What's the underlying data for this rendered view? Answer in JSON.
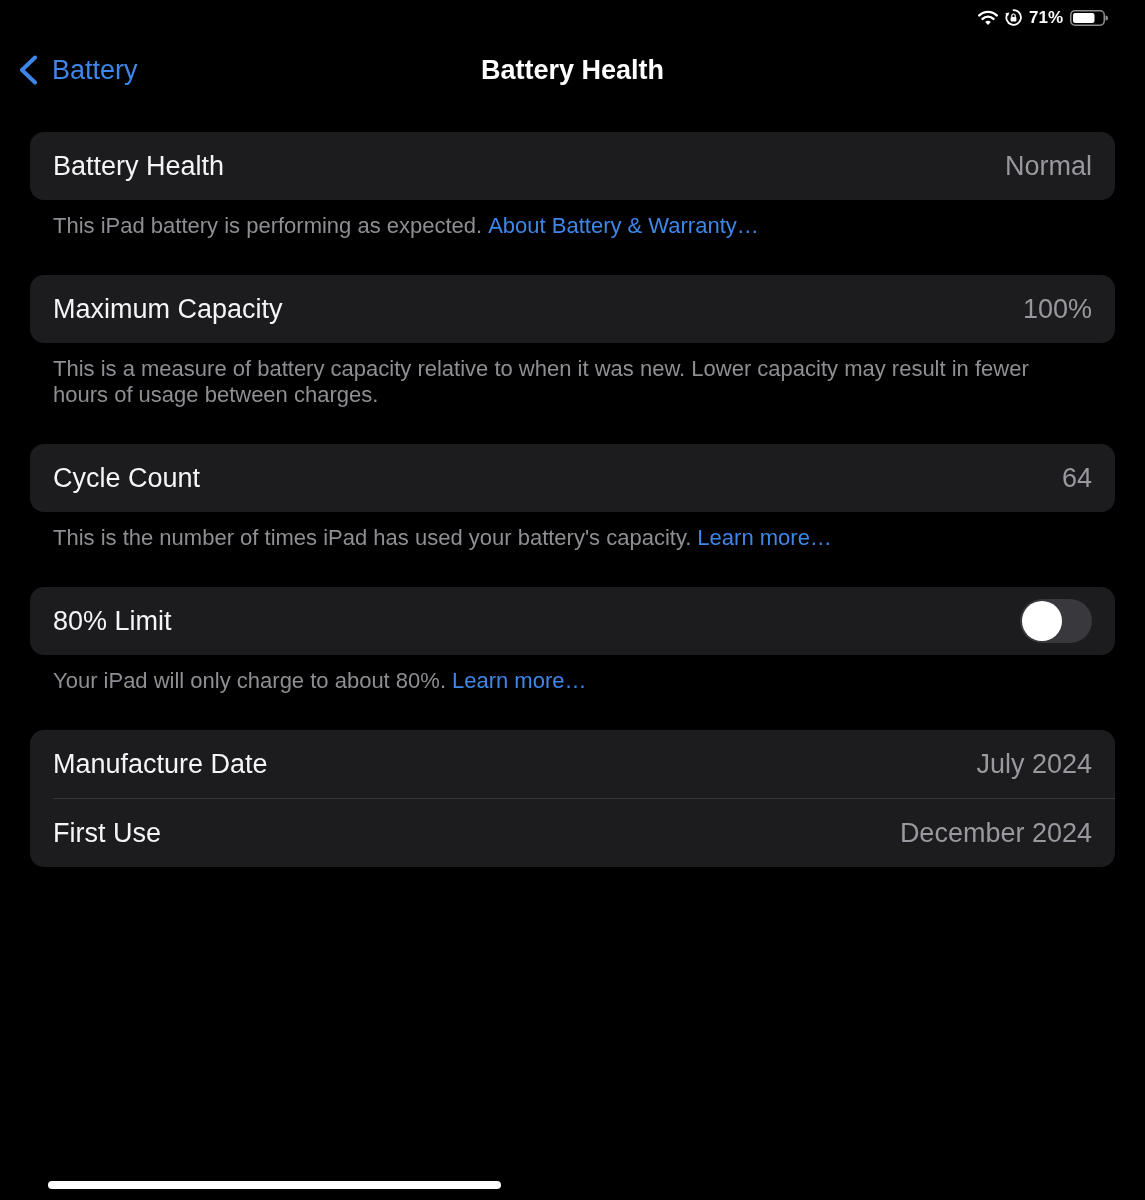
{
  "status_bar": {
    "battery_percent": "71%"
  },
  "nav_bar": {
    "back_label": "Battery",
    "title": "Battery Health"
  },
  "sections": [
    {
      "rows": [
        {
          "kind": "value",
          "label": "Battery Health",
          "value": "Normal"
        }
      ],
      "footer": {
        "text": "This iPad battery is performing as expected.",
        "link": "About Battery & Warranty…"
      }
    },
    {
      "rows": [
        {
          "kind": "value",
          "label": "Maximum Capacity",
          "value": "100%"
        }
      ],
      "footer": {
        "text": "This is a measure of battery capacity relative to when it was new. Lower capacity may result in fewer hours of usage between charges."
      }
    },
    {
      "rows": [
        {
          "kind": "value",
          "label": "Cycle Count",
          "value": "64"
        }
      ],
      "footer": {
        "text": "This is the number of times iPad has used your battery's capacity.",
        "link": "Learn more…"
      }
    },
    {
      "rows": [
        {
          "kind": "toggle",
          "label": "80% Limit",
          "on": false
        }
      ],
      "footer": {
        "text": "Your iPad will only charge to about 80%.",
        "link": "Learn more…"
      }
    },
    {
      "rows": [
        {
          "kind": "value",
          "label": "Manufacture Date",
          "value": "July 2024"
        },
        {
          "kind": "value",
          "label": "First Use",
          "value": "December 2024"
        }
      ]
    }
  ]
}
